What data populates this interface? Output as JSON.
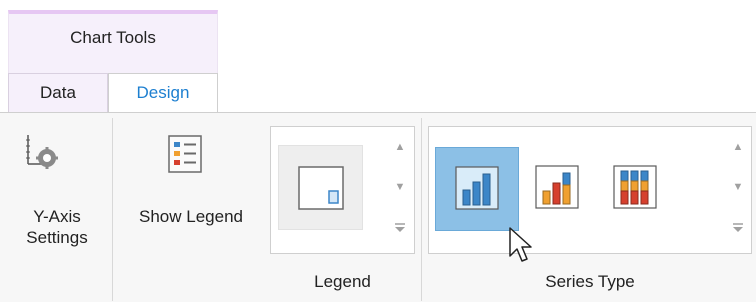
{
  "contextual": {
    "title": "Chart Tools"
  },
  "tabs": [
    {
      "label": "Data",
      "selected": false
    },
    {
      "label": "Design",
      "selected": true
    }
  ],
  "buttons": {
    "y_axis_settings": "Y-Axis\nSettings",
    "show_legend": "Show Legend"
  },
  "groups": {
    "legend": {
      "caption": "Legend"
    },
    "series_type": {
      "caption": "Series Type"
    }
  },
  "colors": {
    "accent": "#1d7fd0",
    "contextual_tint": "#f6f0fb",
    "selection": "#8cc0e6"
  },
  "icons": [
    "y-axis-settings-icon",
    "show-legend-icon",
    "legend-position-icon",
    "clustered-bar-icon",
    "stacked-bar-icon",
    "full-stacked-bar-icon",
    "mouse-cursor-icon"
  ]
}
